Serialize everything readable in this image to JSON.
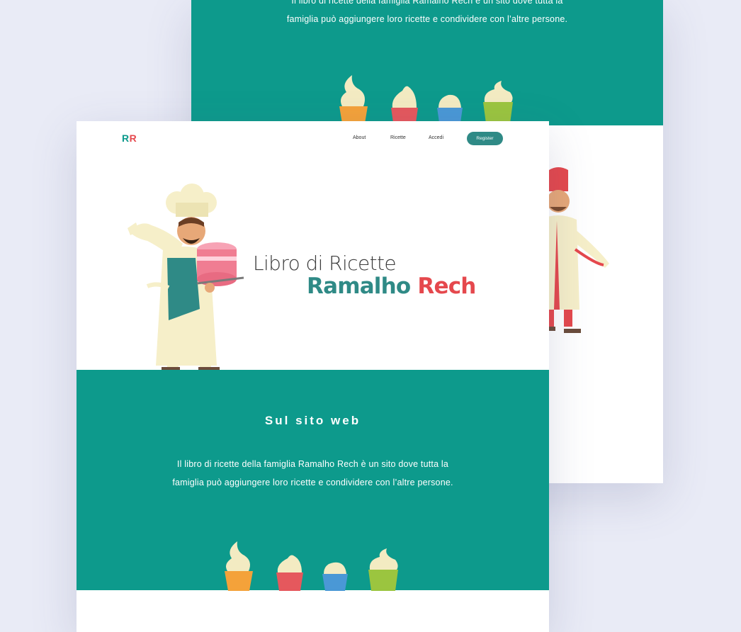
{
  "brand": {
    "logo_left": "R",
    "logo_right": "R"
  },
  "nav": {
    "links": [
      "About",
      "Ricette",
      "Accedi"
    ],
    "register_label": "Register"
  },
  "hero": {
    "title_line1": "Libro di Ricette",
    "name_first": "Ramalho",
    "name_last": "Rech"
  },
  "about": {
    "heading": "Sul sito web",
    "description": "Il libro di ricette della famiglia Ramalho Rech è un sito dove tutta la famiglia può aggiungere loro ricette e condividere con l’altre persone."
  },
  "back_page": {
    "description": "Il libro di ricette della famiglia Ramalho Rech è un sito dove tutta la famiglia può aggiungere loro ricette e condividere con l’altre persone."
  },
  "colors": {
    "teal": "#0d9a8c",
    "accent_red": "#e5484d",
    "button": "#2f8a86",
    "background": "#e9ebf6"
  }
}
